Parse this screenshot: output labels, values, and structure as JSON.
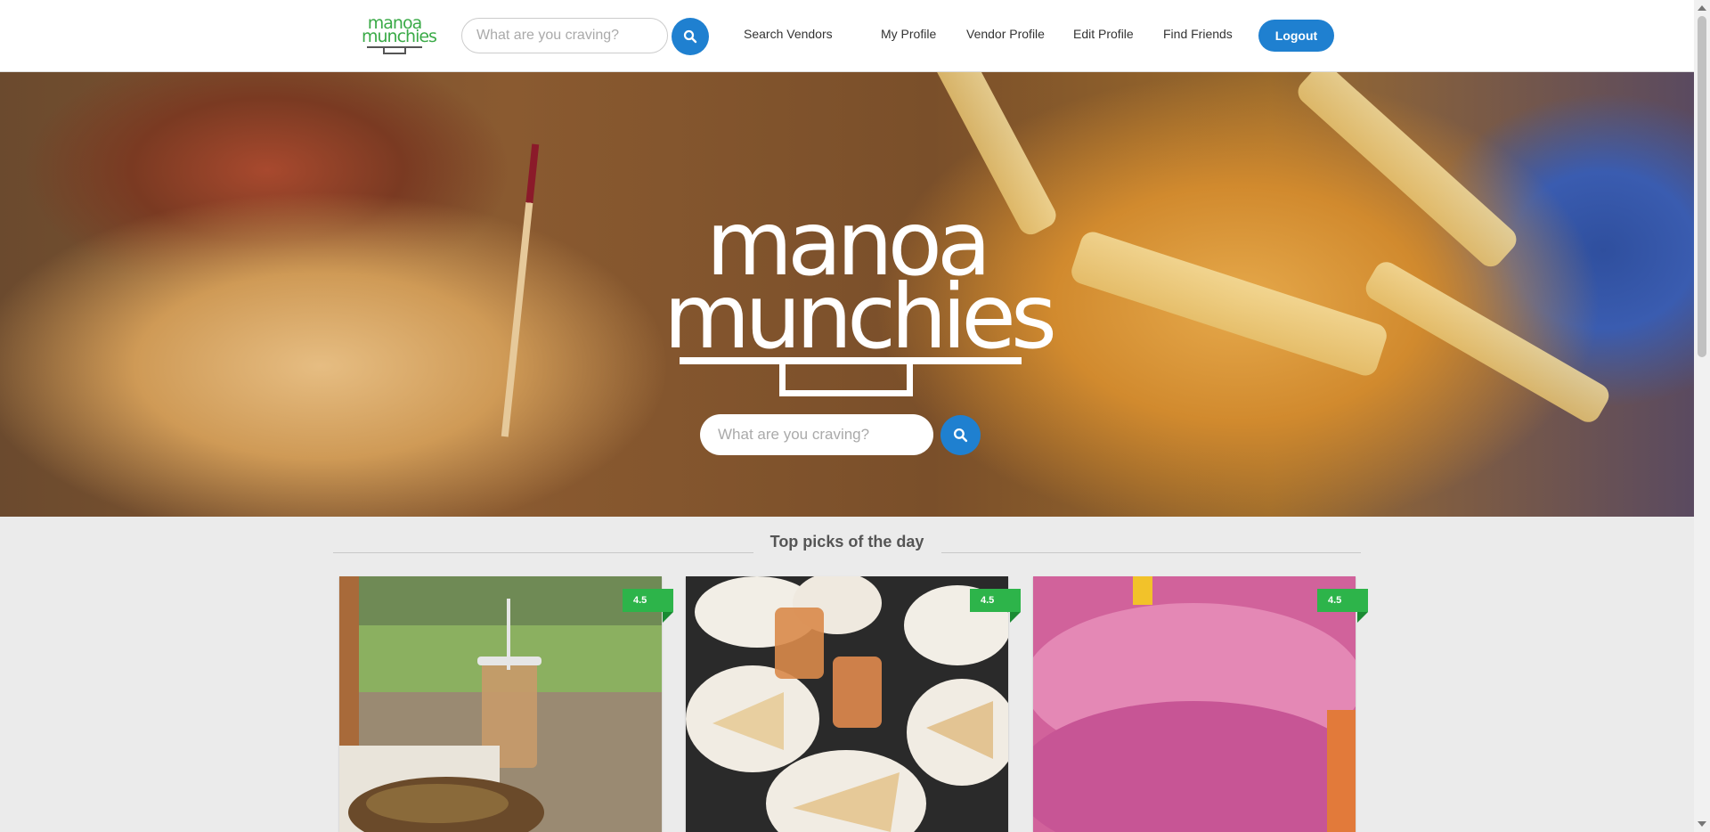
{
  "brand": {
    "line1": "manoa",
    "line2": "munchies"
  },
  "nav": {
    "search_placeholder": "What are you craving?",
    "links": [
      "Search Vendors",
      "My Profile",
      "Vendor Profile",
      "Edit Profile",
      "Find Friends"
    ],
    "logout_label": "Logout"
  },
  "hero": {
    "search_placeholder": "What are you craving?"
  },
  "top_picks": {
    "title": "Top picks of the day",
    "cards": [
      {
        "rating": "4.5",
        "photo": "thai-iced-tea-and-bowl"
      },
      {
        "rating": "4.5",
        "photo": "crepes-and-iced-drinks"
      },
      {
        "rating": "4.5",
        "photo": "berry-smoothie"
      }
    ]
  },
  "colors": {
    "accent": "#1f80d0",
    "brand_green": "#3aaa47",
    "rating_green": "#2db44a"
  }
}
